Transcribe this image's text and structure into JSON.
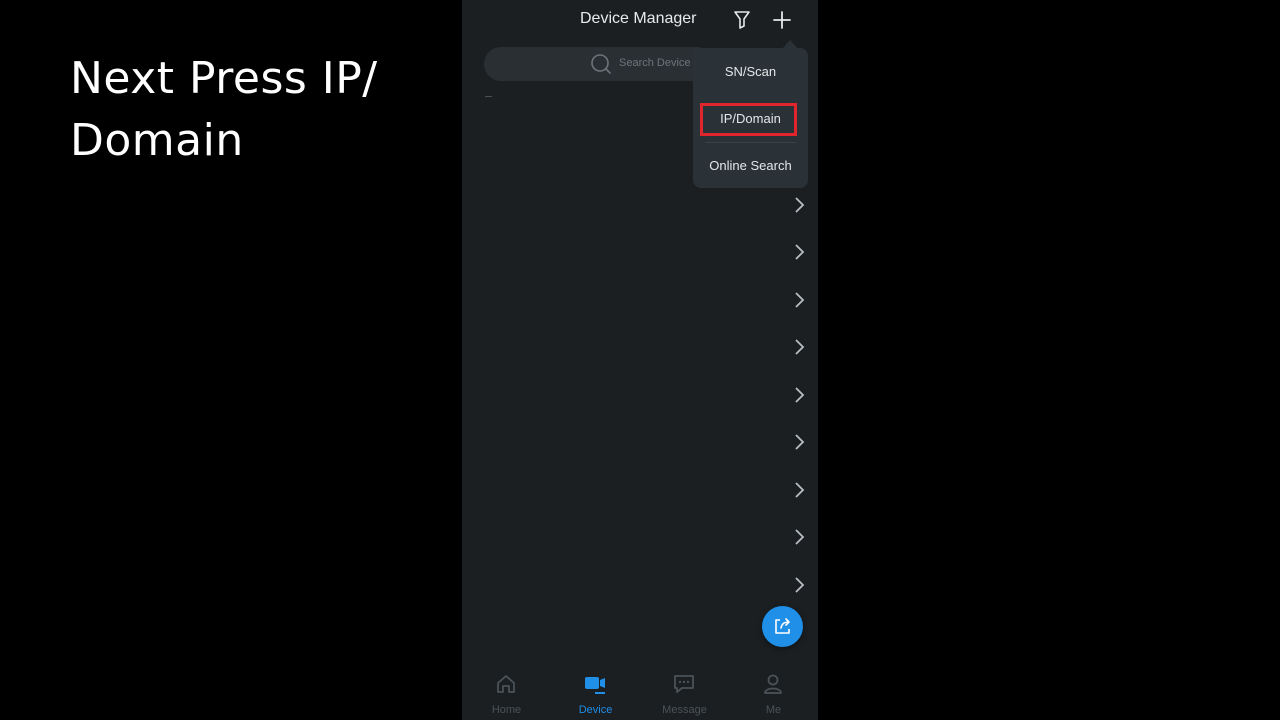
{
  "caption": {
    "line1": "Next Press IP/",
    "line2": "Domain"
  },
  "header": {
    "title": "Device Manager"
  },
  "search": {
    "placeholder": "Search Device"
  },
  "add_menu": {
    "items": [
      {
        "label": "SN/Scan"
      },
      {
        "label": "IP/Domain",
        "highlighted": true
      },
      {
        "label": "Online Search"
      }
    ]
  },
  "tabs": [
    {
      "label": "Home",
      "icon": "home-icon"
    },
    {
      "label": "Device",
      "icon": "device-icon",
      "active": true
    },
    {
      "label": "Message",
      "icon": "message-icon"
    },
    {
      "label": "Me",
      "icon": "person-icon"
    }
  ],
  "colors": {
    "accent": "#1f8fe8",
    "highlight": "#e0252d",
    "background": "#1b1f22"
  }
}
